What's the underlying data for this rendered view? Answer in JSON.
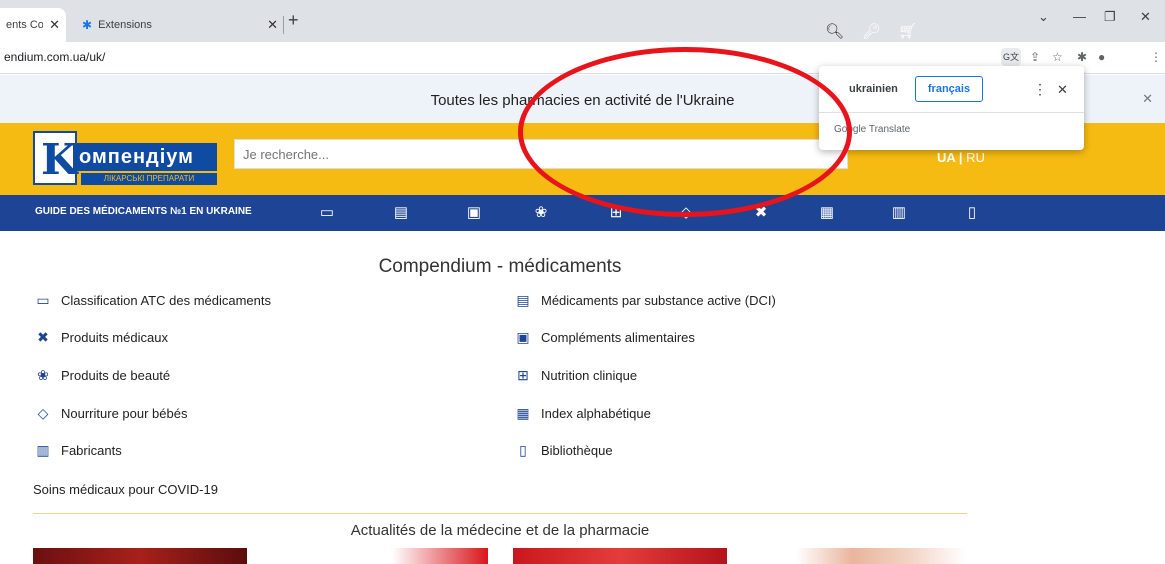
{
  "browser": {
    "tabs": [
      {
        "label": "ents Con",
        "active": true
      },
      {
        "label": "Extensions",
        "active": false
      }
    ],
    "new_tab": "+",
    "url": "endium.com.ua/uk/"
  },
  "site": {
    "banner_text": "Toutes les pharmacies en activité de l'Ukraine",
    "logo_word": "омпендіум",
    "logo_sub": "ЛІКАРСЬКІ ПРЕПАРАТИ",
    "search_placeholder": "Je recherche...",
    "lang_ua": "UA",
    "lang_sep": " | ",
    "lang_ru": "RU",
    "nav_title": "GUIDE DES MÉDICAMENTS №1 EN UKRAINE"
  },
  "translate_popup": {
    "source_lang": "ukrainien",
    "target_lang": "français",
    "brand": "Google Translate"
  },
  "content": {
    "heading": "Compendium - médicaments",
    "left_items": [
      {
        "label": "Classification ATC des médicaments",
        "icon": "atc-folder-icon"
      },
      {
        "label": "Produits médicaux",
        "icon": "bandage-icon"
      },
      {
        "label": "Produits de beauté",
        "icon": "cosmetics-icon"
      },
      {
        "label": "Nourriture pour bébés",
        "icon": "baby-bottle-icon"
      },
      {
        "label": "Fabricants",
        "icon": "barcode-icon"
      }
    ],
    "right_items": [
      {
        "label": "Médicaments par substance active (DCI)",
        "icon": "inn-icon"
      },
      {
        "label": "Compléments alimentaires",
        "icon": "supplement-jar-icon"
      },
      {
        "label": "Nutrition clinique",
        "icon": "clinical-nutrition-icon"
      },
      {
        "label": "Index alphabétique",
        "icon": "alphabet-index-icon"
      },
      {
        "label": "Bibliothèque",
        "icon": "library-books-icon"
      }
    ],
    "covid": "Soins médicaux pour COVID-19",
    "news_heading": "Actualités de la médecine et de la pharmacie"
  },
  "colors": {
    "header_yellow": "#f6bb12",
    "nav_blue": "#1e4496",
    "annotation_red": "#e8141c"
  }
}
